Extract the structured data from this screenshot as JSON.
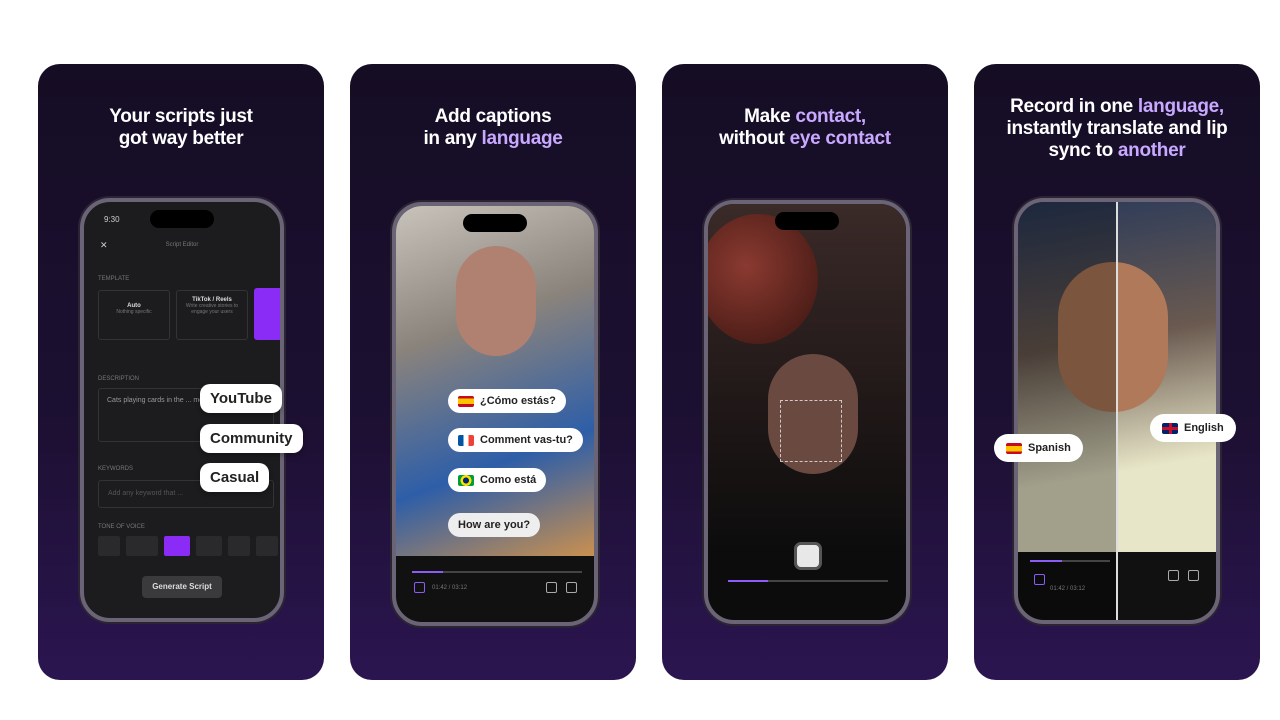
{
  "cards": [
    {
      "title_parts": [
        "Your scripts just",
        "got way better"
      ],
      "phone": {
        "time": "9:30",
        "header": "Script Editor",
        "template_label": "TEMPLATE",
        "templates": [
          {
            "name": "Auto",
            "desc": "Nothing specific"
          },
          {
            "name": "TikTok / Reels",
            "desc": "Write creative stories to engage your users"
          }
        ],
        "description_label": "DESCRIPTION",
        "description_value": "Cats playing cards in the ... meowing",
        "keywords_label": "KEYWORDS",
        "keywords_placeholder": "Add any keyword that ...",
        "tone_label": "TONE OF VOICE",
        "generate_label": "Generate Script"
      },
      "pills": [
        "YouTube",
        "Community",
        "Casual"
      ]
    },
    {
      "title_plain": [
        "Add captions",
        "in any "
      ],
      "title_accent": "language",
      "captions": [
        {
          "flag": "spain",
          "text": "¿Cómo estás?"
        },
        {
          "flag": "france",
          "text": "Comment vas-tu?"
        },
        {
          "flag": "brazil",
          "text": "Como está"
        },
        {
          "flag": "",
          "text": "How are you?"
        }
      ],
      "time": "01:42 / 03:12",
      "progress": 0.18
    },
    {
      "title_plain": [
        "Make ",
        " without "
      ],
      "title_accent": [
        "contact,",
        "eye contact"
      ],
      "progress": 0.25
    },
    {
      "title_lines": [
        [
          "Record in one ",
          "language,"
        ],
        [
          "instantly translate and lip",
          ""
        ],
        [
          "sync to ",
          "another"
        ]
      ],
      "labels": [
        {
          "flag": "spain",
          "text": "Spanish"
        },
        {
          "flag": "uk",
          "text": "English"
        }
      ],
      "time": "01:42 / 03:12",
      "progress": 0.4
    }
  ],
  "colors": {
    "accent": "#c9a8ff",
    "purple": "#8b5cf6"
  }
}
